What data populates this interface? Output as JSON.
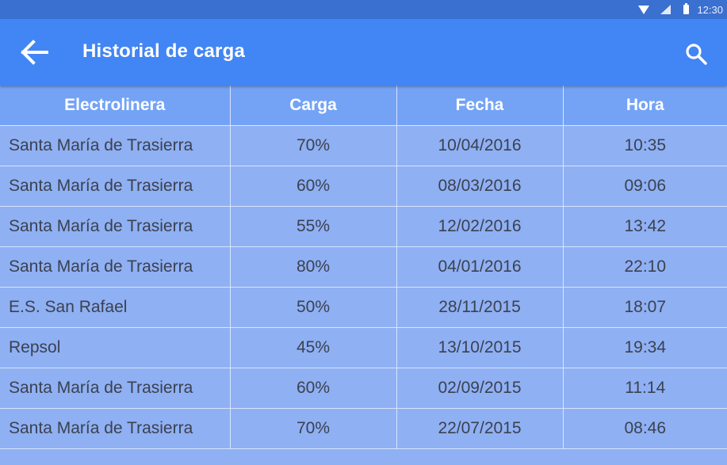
{
  "status_bar": {
    "time": "12:30",
    "icons": [
      "wifi-icon",
      "signal-icon",
      "battery-icon"
    ]
  },
  "app_bar": {
    "title": "Historial de carga",
    "back_icon": "arrow-back-icon",
    "search_icon": "search-icon",
    "color": "#4285f4"
  },
  "table": {
    "headers": [
      "Electrolinera",
      "Carga",
      "Fecha",
      "Hora"
    ],
    "rows": [
      [
        "Santa María de Trasierra",
        "70%",
        "10/04/2016",
        "10:35"
      ],
      [
        "Santa María de Trasierra",
        "60%",
        "08/03/2016",
        "09:06"
      ],
      [
        "Santa María de Trasierra",
        "55%",
        "12/02/2016",
        "13:42"
      ],
      [
        "Santa María de Trasierra",
        "80%",
        "04/01/2016",
        "22:10"
      ],
      [
        "E.S. San Rafael",
        "50%",
        "28/11/2015",
        "18:07"
      ],
      [
        "Repsol",
        "45%",
        "13/10/2015",
        "19:34"
      ],
      [
        "Santa María de Trasierra",
        "60%",
        "02/09/2015",
        "11:14"
      ],
      [
        "Santa María de Trasierra",
        "70%",
        "22/07/2015",
        "08:46"
      ]
    ]
  }
}
